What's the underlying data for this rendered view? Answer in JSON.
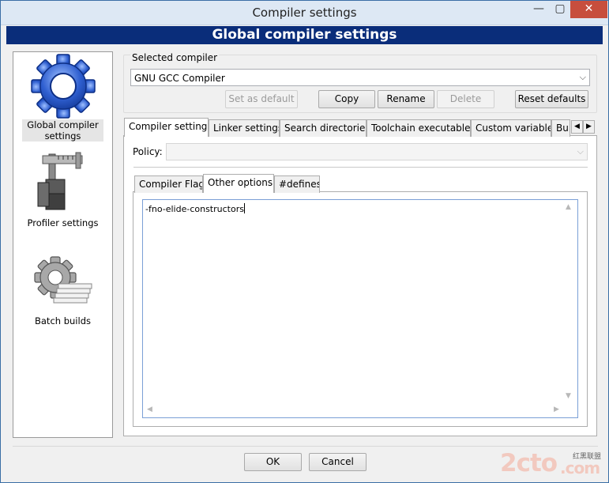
{
  "window": {
    "title": "Compiler settings",
    "min": "—",
    "max": "▢",
    "close": "✕"
  },
  "header": {
    "title": "Global compiler settings"
  },
  "sidebar": {
    "items": [
      {
        "label": "Global compiler settings",
        "icon": "gear-icon",
        "active": true
      },
      {
        "label": "Profiler settings",
        "icon": "caliper-icon",
        "active": false
      },
      {
        "label": "Batch builds",
        "icon": "batch-gear-icon",
        "active": false
      }
    ]
  },
  "compiler": {
    "group_label": "Selected compiler",
    "selected": "GNU GCC Compiler",
    "buttons": {
      "set_default": "Set as default",
      "copy": "Copy",
      "rename": "Rename",
      "delete": "Delete",
      "reset": "Reset defaults"
    }
  },
  "tabs": [
    "Compiler settings",
    "Linker settings",
    "Search directories",
    "Toolchain executables",
    "Custom variables",
    "Bui"
  ],
  "policy": {
    "label": "Policy:",
    "value": ""
  },
  "subtabs": [
    "Compiler Flags",
    "Other options",
    "#defines"
  ],
  "editor": {
    "content": "-fno-elide-constructors"
  },
  "footer": {
    "ok": "OK",
    "cancel": "Cancel"
  },
  "watermark": {
    "main": "2cto",
    "domain": ".com",
    "small": "红黑联盟"
  }
}
